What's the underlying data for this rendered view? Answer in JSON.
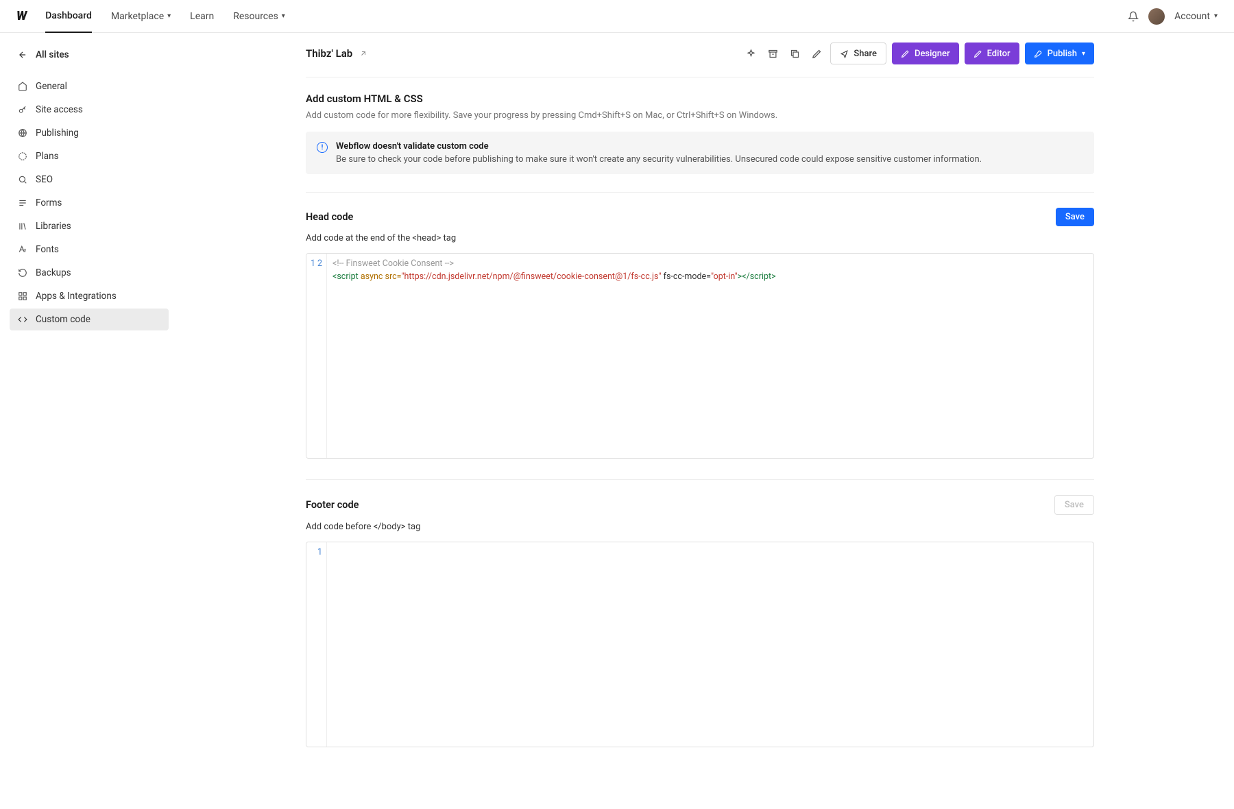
{
  "topnav": {
    "items": [
      "Dashboard",
      "Marketplace",
      "Learn",
      "Resources"
    ],
    "account": "Account"
  },
  "sidebar": {
    "back": "All sites",
    "items": [
      {
        "label": "General"
      },
      {
        "label": "Site access"
      },
      {
        "label": "Publishing"
      },
      {
        "label": "Plans"
      },
      {
        "label": "SEO"
      },
      {
        "label": "Forms"
      },
      {
        "label": "Libraries"
      },
      {
        "label": "Fonts"
      },
      {
        "label": "Backups"
      },
      {
        "label": "Apps & Integrations"
      },
      {
        "label": "Custom code"
      }
    ]
  },
  "page": {
    "title": "Thibz' Lab",
    "share": "Share",
    "designer": "Designer",
    "editor": "Editor",
    "publish": "Publish"
  },
  "main": {
    "heading": "Add custom HTML & CSS",
    "desc": "Add custom code for more flexibility. Save your progress by pressing Cmd+Shift+S on Mac, or Ctrl+Shift+S on Windows.",
    "banner_title": "Webflow doesn't validate custom code",
    "banner_body": "Be sure to check your code before publishing to make sure it won't create any security vulnerabilities. Unsecured code could expose sensitive customer information."
  },
  "head_code": {
    "title": "Head code",
    "save": "Save",
    "desc": "Add code at the end of the <head> tag",
    "gutter": "1\n2",
    "line1_comment": "<!-- Finsweet Cookie Consent -->",
    "line2_tag_open": "<script",
    "line2_attr_async": " async",
    "line2_attr_src": " src=",
    "line2_val_src": "\"https://cdn.jsdelivr.net/npm/@finsweet/cookie-consent@1/fs-cc.js\"",
    "line2_attr_mode": " fs-cc-mode=",
    "line2_val_mode": "\"opt-in\"",
    "line2_close": "></script>"
  },
  "footer_code": {
    "title": "Footer code",
    "save": "Save",
    "desc": "Add code before </body> tag",
    "gutter": "1"
  }
}
